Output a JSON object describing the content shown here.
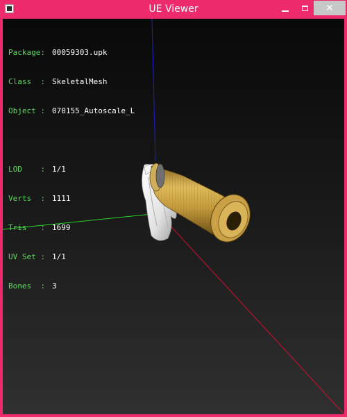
{
  "window": {
    "title": "UE Viewer",
    "close_glyph": "✕"
  },
  "info": {
    "package_label": "Package:",
    "package_value": "00059303.upk",
    "class_label": "Class  :",
    "class_value": "SkeletalMesh",
    "object_label": "Object :",
    "object_value": "070155_Autoscale_L",
    "lod_label": "LOD    :",
    "lod_value": "1/1",
    "verts_label": "Verts  :",
    "verts_value": "1111",
    "tris_label": "Tris   :",
    "tris_value": "1699",
    "uvset_label": "UV Set :",
    "uvset_value": "1/1",
    "bones_label": "Bones  :",
    "bones_value": "3"
  },
  "colors": {
    "frame": "#ec2a6c",
    "label_green": "#5ad95a",
    "axis_x": "#d01030",
    "axis_y": "#2bd42b",
    "axis_z": "#2020c8",
    "barrel": "#c49a3a"
  },
  "icons": {
    "app": "app-icon",
    "minimize": "minimize-icon",
    "maximize": "maximize-icon",
    "close": "close-icon"
  }
}
